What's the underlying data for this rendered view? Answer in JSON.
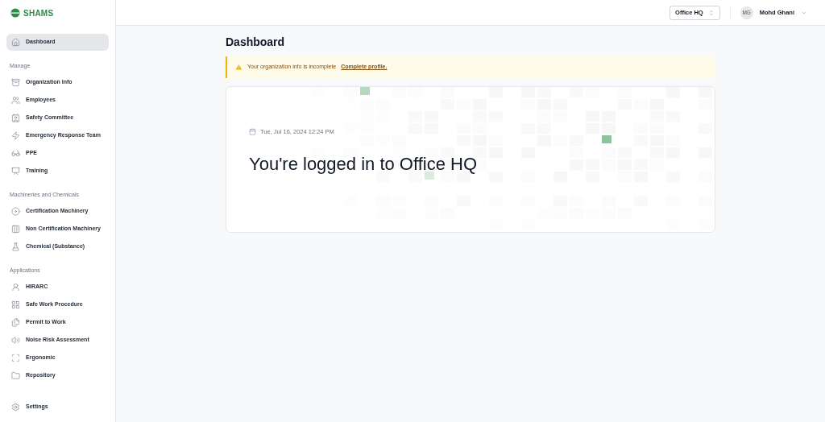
{
  "brand": "SHAMS",
  "sidebar": {
    "top": [
      {
        "label": "Dashboard",
        "selected": true
      }
    ],
    "sections": [
      {
        "title": "Manage",
        "items": [
          {
            "label": "Organization Info",
            "selected": false
          },
          {
            "label": "Employees",
            "selected": false
          },
          {
            "label": "Safety Committee",
            "selected": false
          },
          {
            "label": "Emergency Response Team",
            "selected": false
          },
          {
            "label": "PPE",
            "selected": false
          },
          {
            "label": "Training",
            "selected": false
          }
        ]
      },
      {
        "title": "Machineries and Chemicals",
        "items": [
          {
            "label": "Certification Machinery",
            "selected": false
          },
          {
            "label": "Non Certification Machinery",
            "selected": false
          },
          {
            "label": "Chemical (Substance)",
            "selected": false
          }
        ]
      },
      {
        "title": "Applications",
        "items": [
          {
            "label": "HIRARC",
            "selected": false
          },
          {
            "label": "Safe Work Procedure",
            "selected": false
          },
          {
            "label": "Permit to Work",
            "selected": false
          },
          {
            "label": "Noise Risk Assessment",
            "selected": false
          },
          {
            "label": "Ergonomic",
            "selected": false
          },
          {
            "label": "Repository",
            "selected": false
          }
        ]
      }
    ],
    "bottom": [
      {
        "label": "Settings",
        "selected": false
      }
    ]
  },
  "header": {
    "location": "Office HQ",
    "user_initials": "MG",
    "user_name": "Mohd Ghani"
  },
  "page_title": "Dashboard",
  "alert": {
    "message": "Your organization info is incomplete",
    "link": "Complete profile."
  },
  "welcome": {
    "date": "Tue, Jul 16, 2024 12:24 PM",
    "heading": "You're logged in to Office HQ"
  }
}
